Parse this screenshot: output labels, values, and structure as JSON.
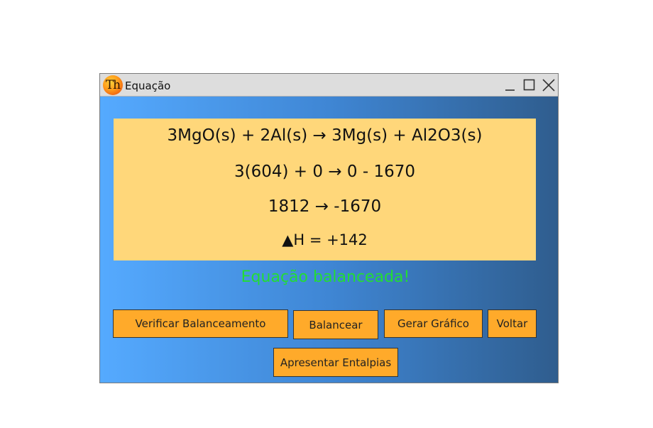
{
  "window": {
    "title": "Equação",
    "app_icon_text": "Th",
    "icons": {
      "minimize": "minimize-icon",
      "maximize": "maximize-icon",
      "close": "close-icon"
    }
  },
  "equation": {
    "line1": "3MgO(s) + 2Al(s) → 3Mg(s) + Al2O3(s)",
    "line2": "3(604) + 0 → 0 - 1670",
    "line3": "1812 → -1670",
    "line4": "▲H = +142"
  },
  "status": {
    "message": "Equação balanceada!",
    "color": "#22dd33"
  },
  "buttons": {
    "verify": "Verificar Balanceamento",
    "balance": "Balancear",
    "chart": "Gerar Gráfico",
    "back": "Voltar",
    "enthalpy": "Apresentar Entalpias"
  },
  "colors": {
    "panel": "#ffd77a",
    "button": "#ffaa2a",
    "gradient_start": "#55aaff",
    "gradient_end": "#2f5d8e",
    "titlebar": "#dddddd"
  }
}
